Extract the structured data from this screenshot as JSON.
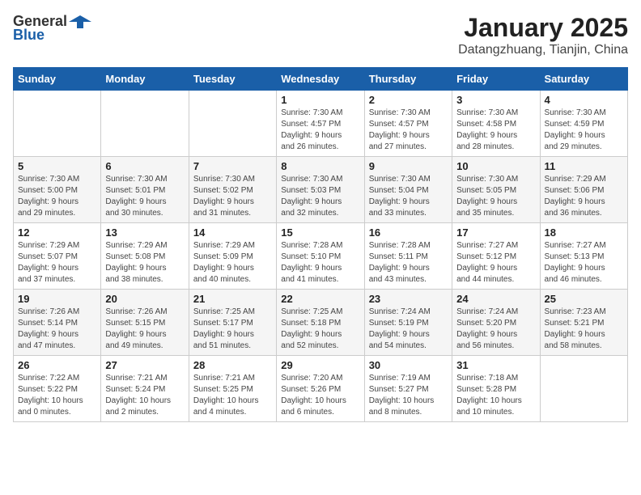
{
  "header": {
    "logo_general": "General",
    "logo_blue": "Blue",
    "title": "January 2025",
    "subtitle": "Datangzhuang, Tianjin, China"
  },
  "days_of_week": [
    "Sunday",
    "Monday",
    "Tuesday",
    "Wednesday",
    "Thursday",
    "Friday",
    "Saturday"
  ],
  "weeks": [
    [
      {
        "day": "",
        "info": ""
      },
      {
        "day": "",
        "info": ""
      },
      {
        "day": "",
        "info": ""
      },
      {
        "day": "1",
        "info": "Sunrise: 7:30 AM\nSunset: 4:57 PM\nDaylight: 9 hours\nand 26 minutes."
      },
      {
        "day": "2",
        "info": "Sunrise: 7:30 AM\nSunset: 4:57 PM\nDaylight: 9 hours\nand 27 minutes."
      },
      {
        "day": "3",
        "info": "Sunrise: 7:30 AM\nSunset: 4:58 PM\nDaylight: 9 hours\nand 28 minutes."
      },
      {
        "day": "4",
        "info": "Sunrise: 7:30 AM\nSunset: 4:59 PM\nDaylight: 9 hours\nand 29 minutes."
      }
    ],
    [
      {
        "day": "5",
        "info": "Sunrise: 7:30 AM\nSunset: 5:00 PM\nDaylight: 9 hours\nand 29 minutes."
      },
      {
        "day": "6",
        "info": "Sunrise: 7:30 AM\nSunset: 5:01 PM\nDaylight: 9 hours\nand 30 minutes."
      },
      {
        "day": "7",
        "info": "Sunrise: 7:30 AM\nSunset: 5:02 PM\nDaylight: 9 hours\nand 31 minutes."
      },
      {
        "day": "8",
        "info": "Sunrise: 7:30 AM\nSunset: 5:03 PM\nDaylight: 9 hours\nand 32 minutes."
      },
      {
        "day": "9",
        "info": "Sunrise: 7:30 AM\nSunset: 5:04 PM\nDaylight: 9 hours\nand 33 minutes."
      },
      {
        "day": "10",
        "info": "Sunrise: 7:30 AM\nSunset: 5:05 PM\nDaylight: 9 hours\nand 35 minutes."
      },
      {
        "day": "11",
        "info": "Sunrise: 7:29 AM\nSunset: 5:06 PM\nDaylight: 9 hours\nand 36 minutes."
      }
    ],
    [
      {
        "day": "12",
        "info": "Sunrise: 7:29 AM\nSunset: 5:07 PM\nDaylight: 9 hours\nand 37 minutes."
      },
      {
        "day": "13",
        "info": "Sunrise: 7:29 AM\nSunset: 5:08 PM\nDaylight: 9 hours\nand 38 minutes."
      },
      {
        "day": "14",
        "info": "Sunrise: 7:29 AM\nSunset: 5:09 PM\nDaylight: 9 hours\nand 40 minutes."
      },
      {
        "day": "15",
        "info": "Sunrise: 7:28 AM\nSunset: 5:10 PM\nDaylight: 9 hours\nand 41 minutes."
      },
      {
        "day": "16",
        "info": "Sunrise: 7:28 AM\nSunset: 5:11 PM\nDaylight: 9 hours\nand 43 minutes."
      },
      {
        "day": "17",
        "info": "Sunrise: 7:27 AM\nSunset: 5:12 PM\nDaylight: 9 hours\nand 44 minutes."
      },
      {
        "day": "18",
        "info": "Sunrise: 7:27 AM\nSunset: 5:13 PM\nDaylight: 9 hours\nand 46 minutes."
      }
    ],
    [
      {
        "day": "19",
        "info": "Sunrise: 7:26 AM\nSunset: 5:14 PM\nDaylight: 9 hours\nand 47 minutes."
      },
      {
        "day": "20",
        "info": "Sunrise: 7:26 AM\nSunset: 5:15 PM\nDaylight: 9 hours\nand 49 minutes."
      },
      {
        "day": "21",
        "info": "Sunrise: 7:25 AM\nSunset: 5:17 PM\nDaylight: 9 hours\nand 51 minutes."
      },
      {
        "day": "22",
        "info": "Sunrise: 7:25 AM\nSunset: 5:18 PM\nDaylight: 9 hours\nand 52 minutes."
      },
      {
        "day": "23",
        "info": "Sunrise: 7:24 AM\nSunset: 5:19 PM\nDaylight: 9 hours\nand 54 minutes."
      },
      {
        "day": "24",
        "info": "Sunrise: 7:24 AM\nSunset: 5:20 PM\nDaylight: 9 hours\nand 56 minutes."
      },
      {
        "day": "25",
        "info": "Sunrise: 7:23 AM\nSunset: 5:21 PM\nDaylight: 9 hours\nand 58 minutes."
      }
    ],
    [
      {
        "day": "26",
        "info": "Sunrise: 7:22 AM\nSunset: 5:22 PM\nDaylight: 10 hours\nand 0 minutes."
      },
      {
        "day": "27",
        "info": "Sunrise: 7:21 AM\nSunset: 5:24 PM\nDaylight: 10 hours\nand 2 minutes."
      },
      {
        "day": "28",
        "info": "Sunrise: 7:21 AM\nSunset: 5:25 PM\nDaylight: 10 hours\nand 4 minutes."
      },
      {
        "day": "29",
        "info": "Sunrise: 7:20 AM\nSunset: 5:26 PM\nDaylight: 10 hours\nand 6 minutes."
      },
      {
        "day": "30",
        "info": "Sunrise: 7:19 AM\nSunset: 5:27 PM\nDaylight: 10 hours\nand 8 minutes."
      },
      {
        "day": "31",
        "info": "Sunrise: 7:18 AM\nSunset: 5:28 PM\nDaylight: 10 hours\nand 10 minutes."
      },
      {
        "day": "",
        "info": ""
      }
    ]
  ]
}
